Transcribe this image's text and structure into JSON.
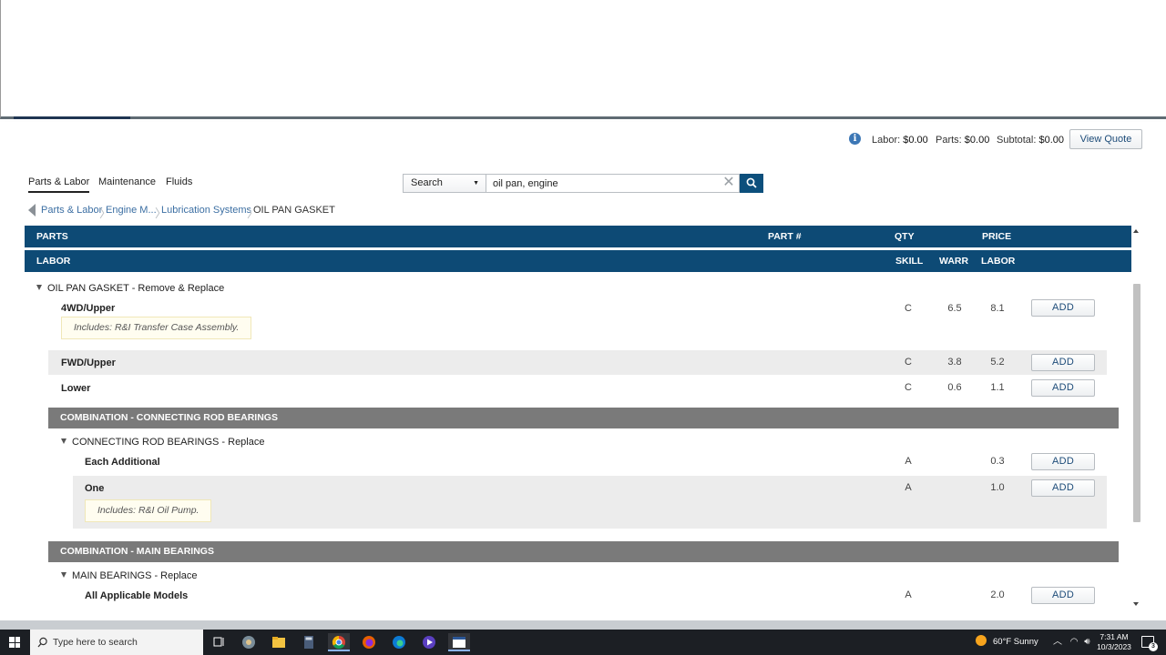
{
  "summary": {
    "labor_label": "Labor:",
    "labor_value": "$0.00",
    "parts_label": "Parts:",
    "parts_value": "$0.00",
    "subtotal_label": "Subtotal:",
    "subtotal_value": "$0.00",
    "view_quote": "View Quote"
  },
  "tabs": [
    {
      "label": "Parts & Labor",
      "active": true
    },
    {
      "label": "Maintenance",
      "active": false
    },
    {
      "label": "Fluids",
      "active": false
    }
  ],
  "search": {
    "select_value": "Search",
    "query": "oil pan, engine"
  },
  "breadcrumb": [
    "Parts & Labor",
    "Engine M...",
    "Lubrication Systems",
    "OIL PAN GASKET"
  ],
  "parts_header": {
    "parts": "PARTS",
    "part_no": "PART #",
    "qty": "QTY",
    "price": "PRICE"
  },
  "labor_header": {
    "labor": "LABOR",
    "skill": "SKILL",
    "warr": "WARR",
    "labor_col": "LABOR"
  },
  "section1": {
    "title": "OIL PAN GASKET - Remove & Replace",
    "rows": [
      {
        "name": "4WD/Upper",
        "skill": "C",
        "warr": "6.5",
        "labor": "8.1",
        "note": "Includes: R&I Transfer Case Assembly."
      },
      {
        "name": "FWD/Upper",
        "skill": "C",
        "warr": "3.8",
        "labor": "5.2"
      },
      {
        "name": "Lower",
        "skill": "C",
        "warr": "0.6",
        "labor": "1.1"
      }
    ]
  },
  "combo1": {
    "header": "COMBINATION - CONNECTING ROD BEARINGS",
    "title": "CONNECTING ROD BEARINGS - Replace",
    "rows": [
      {
        "name": "Each Additional",
        "skill": "A",
        "labor": "0.3"
      },
      {
        "name": "One",
        "skill": "A",
        "labor": "1.0",
        "note": "Includes: R&I Oil Pump."
      }
    ]
  },
  "combo2": {
    "header": "COMBINATION - MAIN BEARINGS",
    "title": "MAIN BEARINGS - Replace",
    "rows": [
      {
        "name": "All Applicable Models",
        "skill": "A",
        "labor": "2.0"
      }
    ]
  },
  "add_label": "ADD",
  "taskbar": {
    "search_placeholder": "Type here to search",
    "weather": "60°F  Sunny",
    "time": "7:31 AM",
    "date": "10/3/2023",
    "notification_count": "3"
  }
}
